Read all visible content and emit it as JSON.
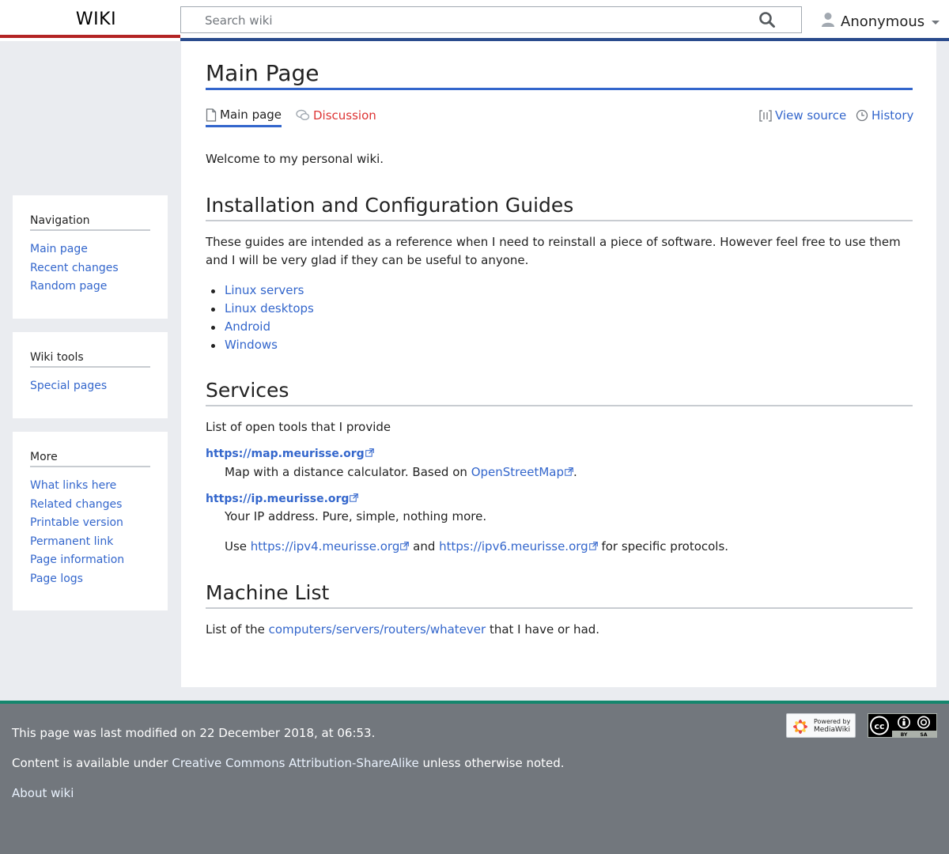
{
  "header": {
    "logo": "WIKI",
    "search_placeholder": "Search wiki",
    "user_label": "Anonymous"
  },
  "sidebar": {
    "navigation": {
      "title": "Navigation",
      "items": [
        "Main page",
        "Recent changes",
        "Random page"
      ]
    },
    "wiki_tools": {
      "title": "Wiki tools",
      "items": [
        "Special pages"
      ]
    },
    "more": {
      "title": "More",
      "items": [
        "What links here",
        "Related changes",
        "Printable version",
        "Permanent link",
        "Page information",
        "Page logs"
      ]
    }
  },
  "page": {
    "title": "Main Page",
    "tabs": {
      "main": "Main page",
      "discussion": "Discussion",
      "view_source": "View source",
      "history": "History"
    },
    "welcome": "Welcome to my personal wiki.",
    "section1": {
      "heading": "Installation and Configuration Guides",
      "text": "These guides are intended as a reference when I need to reinstall a piece of software. However feel free to use them and I will be very glad if they can be useful to anyone.",
      "links": [
        "Linux servers",
        "Linux desktops",
        "Android",
        "Windows"
      ]
    },
    "section2": {
      "heading": "Services",
      "intro": "List of open tools that I provide",
      "map_link": "https://map.meurisse.org",
      "map_desc_prefix": "Map with a distance calculator. Based on ",
      "map_desc_link": "OpenStreetMap",
      "map_desc_suffix": ".",
      "ip_link": "https://ip.meurisse.org",
      "ip_desc": "Your IP address. Pure, simple, nothing more.",
      "use_prefix": "Use ",
      "ipv4_link": "https://ipv4.meurisse.org",
      "use_and": " and ",
      "ipv6_link": "https://ipv6.meurisse.org",
      "use_suffix": " for specific protocols."
    },
    "section3": {
      "heading": "Machine List",
      "prefix": "List of the ",
      "link": "computers/servers/routers/whatever",
      "suffix": " that I have or had."
    }
  },
  "footer": {
    "last_modified": "This page was last modified on 22 December 2018, at 06:53.",
    "content_prefix": "Content is available under ",
    "license_link": "Creative Commons Attribution-ShareAlike",
    "content_suffix": " unless otherwise noted.",
    "about": "About wiki",
    "mw_badge_line1": "Powered by",
    "mw_badge_line2": "MediaWiki",
    "cc_by": "BY",
    "cc_sa": "SA"
  },
  "colors": {
    "link": "#3366cc",
    "new_link": "#dd3333",
    "header_left_rule": "#b32424",
    "header_right_rule": "#2a4b8d",
    "footer_bg": "#72777d",
    "footer_rule": "#14866d"
  },
  "icons": {
    "search": "search-icon",
    "user": "user-icon",
    "page": "page-icon",
    "discussion": "speech-bubbles-icon",
    "view_source": "brackets-icon",
    "history": "clock-icon",
    "external": "external-link-icon"
  }
}
